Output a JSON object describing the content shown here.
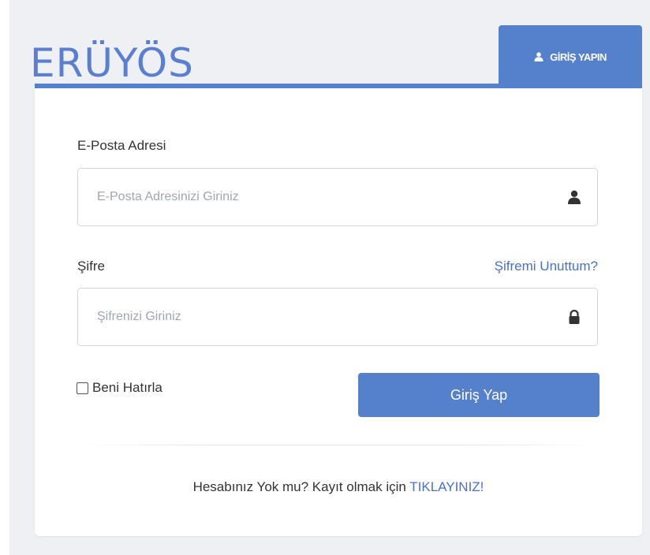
{
  "brand": {
    "name": "ERÜYÖS"
  },
  "login_tab": {
    "label": "GİRİŞ YAPIN"
  },
  "form": {
    "email_label": "E-Posta Adresi",
    "email_placeholder": "E-Posta Adresinizi Giriniz",
    "email_value": "",
    "password_label": "Şifre",
    "password_placeholder": "Şifrenizi Giriniz",
    "password_value": "",
    "forgot_link": "Şifremi Unuttum?",
    "remember_label": "Beni Hatırla",
    "remember_checked": false,
    "submit_label": "Giriş Yap"
  },
  "signup": {
    "text": "Hesabınız Yok mu? Kayıt olmak için",
    "link": "TIKLAYINIZ!"
  },
  "colors": {
    "accent": "#5580cc",
    "link": "#4a71c7",
    "background": "#eef0f3"
  },
  "icons": {
    "tab_icon": "user-icon",
    "email_icon": "user-icon",
    "password_icon": "lock-icon"
  }
}
